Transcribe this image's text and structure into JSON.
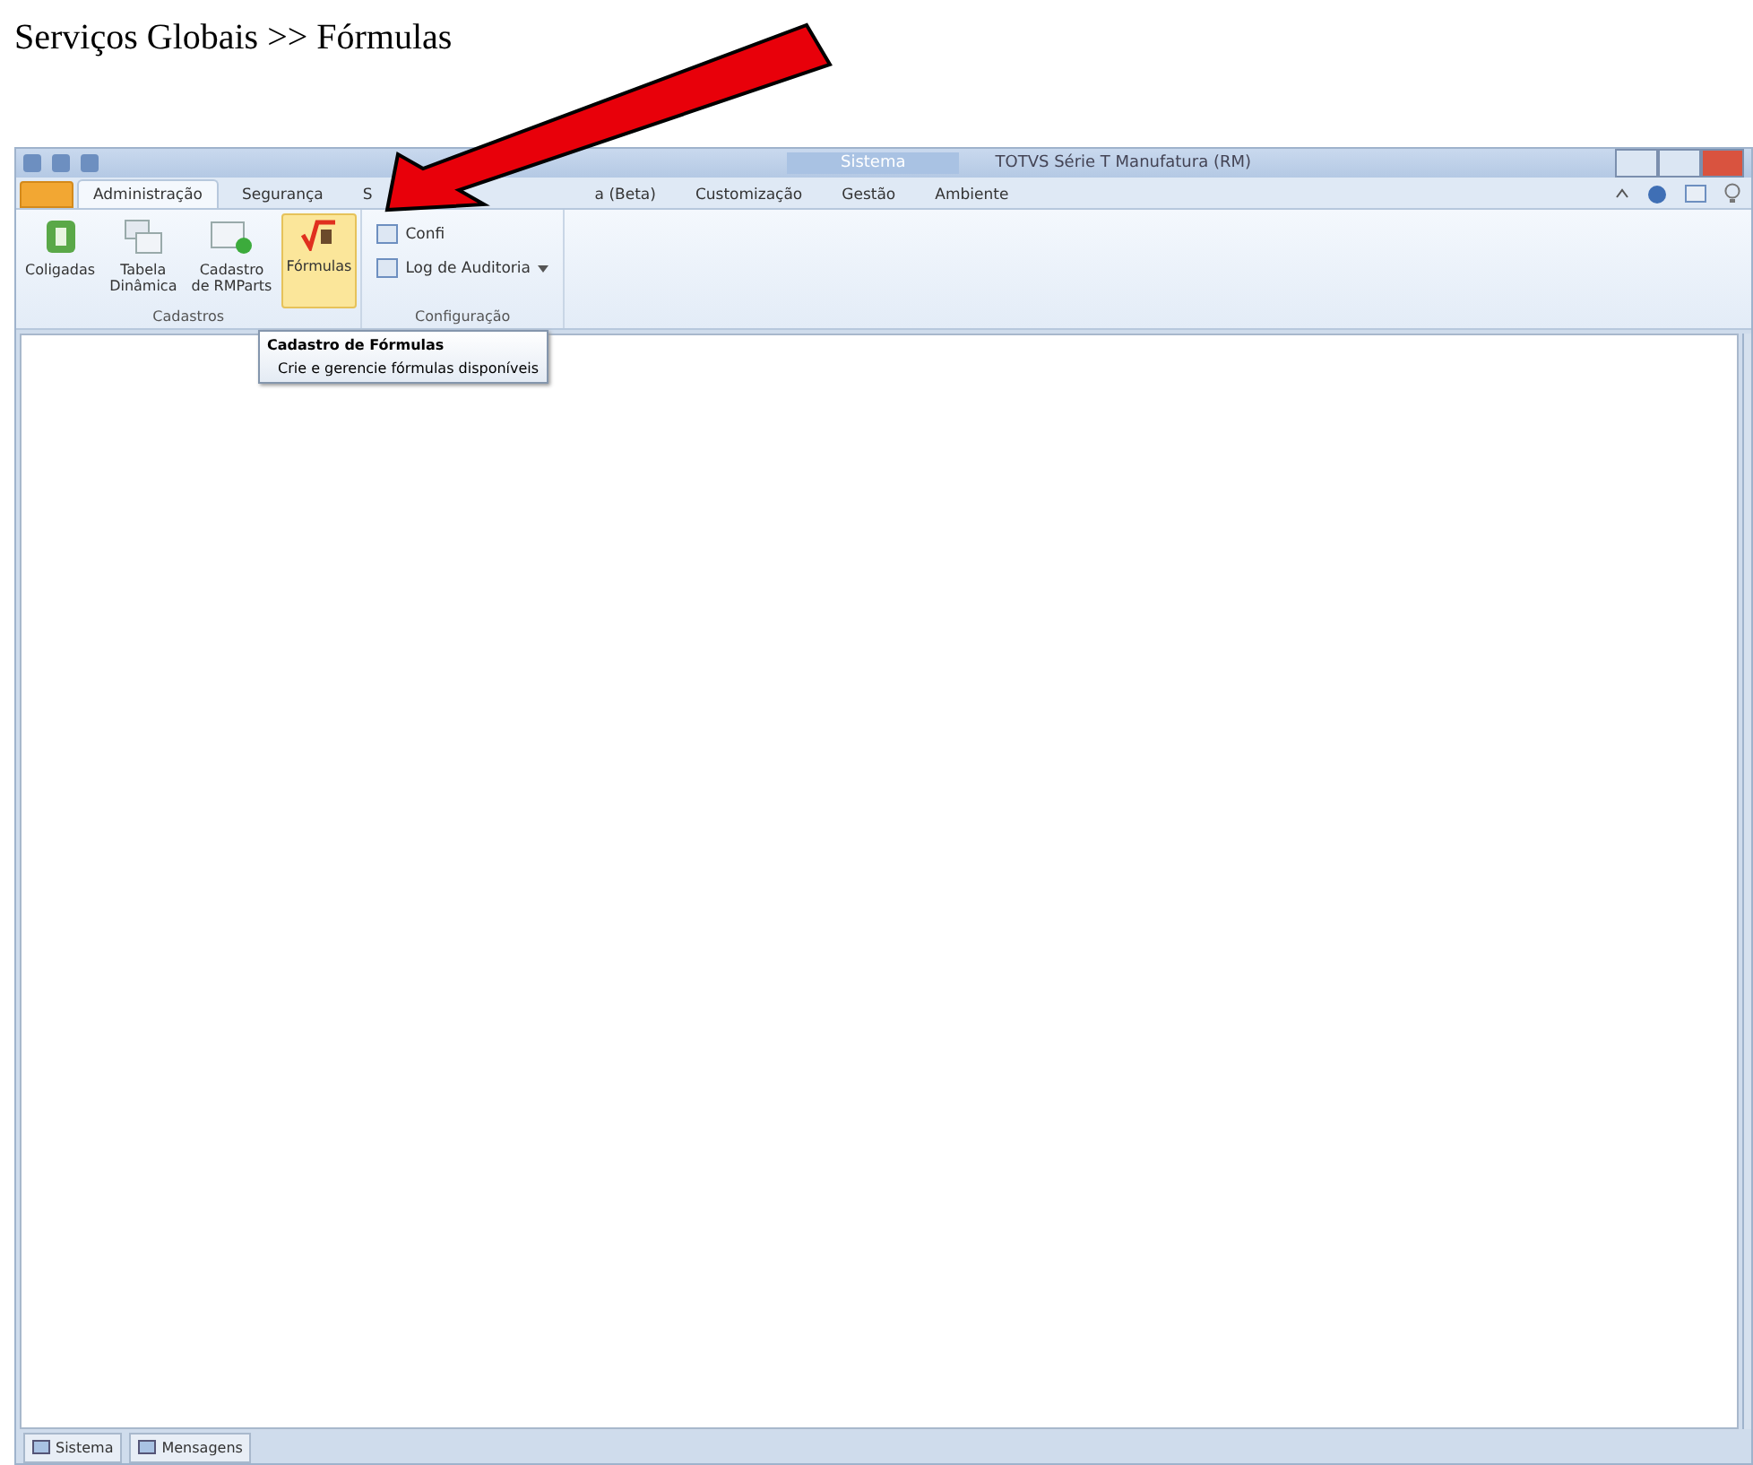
{
  "caption": "Serviços Globais >> Fórmulas",
  "window": {
    "app_tab": "Sistema",
    "title": "TOTVS Série T Manufatura (RM)"
  },
  "tabs": [
    {
      "label": "Administração",
      "selected": true
    },
    {
      "label": "Segurança",
      "selected": false
    },
    {
      "label": "S",
      "selected": false
    },
    {
      "label": "a (Beta)",
      "selected": false
    },
    {
      "label": "Customização",
      "selected": false
    },
    {
      "label": "Gestão",
      "selected": false
    },
    {
      "label": "Ambiente",
      "selected": false
    }
  ],
  "groups": [
    {
      "label": "Cadastros",
      "buttons": [
        {
          "label": "Coligadas",
          "kind": "building",
          "selected": false
        },
        {
          "label": "Tabela Dinâmica",
          "kind": "windows",
          "selected": false
        },
        {
          "label": "Cadastro de RMParts",
          "kind": "window",
          "selected": false
        },
        {
          "label": "Fórmulas",
          "kind": "formula",
          "selected": true
        }
      ]
    },
    {
      "label": "Configuração",
      "small_buttons": [
        {
          "label": "Confi",
          "dropdown": false
        },
        {
          "label": "Log de Auditoria",
          "dropdown": true
        }
      ]
    }
  ],
  "tooltip": {
    "title": "Cadastro de Fórmulas",
    "text": "Crie e gerencie fórmulas disponíveis"
  },
  "status_tabs": [
    "Sistema",
    "Mensagens"
  ]
}
